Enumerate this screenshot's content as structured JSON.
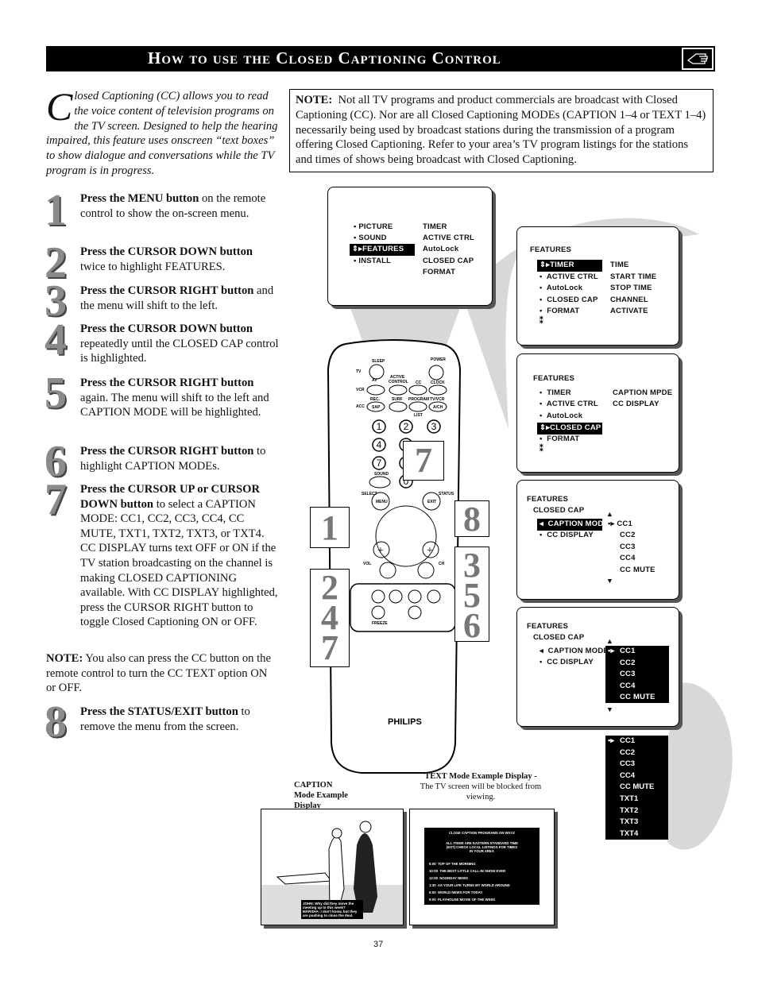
{
  "header": {
    "title": "How to use the Closed Captioning Control",
    "icon": "pointing-hand-icon"
  },
  "intro": {
    "dropcap": "C",
    "text": "losed Captioning (CC) allows you to read the voice content of television programs on the TV screen.  Designed to help the hearing impaired, this feature uses onscreen “text boxes” to show dialogue and conversations while the TV program is in progress."
  },
  "note": {
    "label": "NOTE:",
    "text": "Not all TV programs and product commercials are broadcast with Closed Captioning (CC).  Nor are all Closed Captioning  MODEs (CAPTION 1–4 or TEXT 1–4) necessarily being used by broadcast stations during the transmission of a program offering Closed Captioning.  Refer to your area’s TV program listings for the stations and times of shows being broadcast with Closed Captioning."
  },
  "steps": [
    {
      "num": "1",
      "bold": "Press the MENU button",
      "text": " on the remote control to show the on-screen menu."
    },
    {
      "num": "2",
      "bold": "Press the CURSOR DOWN button",
      "text": " twice to highlight FEATURES."
    },
    {
      "num": "3",
      "bold": "Press the CURSOR RIGHT button",
      "text": " and the menu will shift to the left."
    },
    {
      "num": "4",
      "bold": "Press the CURSOR DOWN button",
      "text": " repeatedly until the CLOSED CAP control is highlighted."
    },
    {
      "num": "5",
      "bold": "Press the CURSOR RIGHT button",
      "text": " again. The menu will shift to the left and CAPTION MODE will be highlighted."
    },
    {
      "num": "6",
      "bold": "Press the CURSOR RIGHT button",
      "text": " to highlight CAPTION MODEs."
    },
    {
      "num": "7",
      "bold": "Press the CURSOR UP or CURSOR DOWN button",
      "text": " to select a CAPTION MODE:  CC1, CC2, CC3, CC4, CC MUTE, TXT1, TXT2, TXT3, or TXT4.  CC DISPLAY turns text OFF or ON if the TV station broadcasting on the channel is making CLOSED CAPTIONING available. With CC DISPLAY highlighted, press the CURSOR RIGHT button to toggle Closed Captioning ON or OFF."
    },
    {
      "num": "8",
      "bold": "Press the STATUS/EXIT button",
      "text": " to remove the menu from the screen."
    }
  ],
  "note2": {
    "label": "NOTE:",
    "text": " You also can press the CC button on the remote control to turn the CC TEXT option ON or OFF."
  },
  "menus": {
    "main": {
      "left": [
        "PICTURE",
        "SOUND",
        "FEATURES",
        "INSTALL"
      ],
      "right": [
        "TIMER",
        "ACTIVE CTRL",
        "AutoLock",
        "CLOSED CAP",
        "FORMAT"
      ]
    },
    "features1": {
      "title": "FEATURES",
      "left": [
        "TIMER",
        "ACTIVE CTRL",
        "AutoLock",
        "CLOSED CAP",
        "FORMAT"
      ],
      "right": [
        "TIME",
        "START TIME",
        "STOP TIME",
        "CHANNEL",
        "ACTIVATE"
      ]
    },
    "features2": {
      "title": "FEATURES",
      "left": [
        "TIMER",
        "ACTIVE CTRL",
        "AutoLock",
        "CLOSED CAP",
        "FORMAT"
      ],
      "right": [
        "CAPTION MPDE",
        "CC DISPLAY"
      ]
    },
    "cc1": {
      "title": "FEATURES",
      "sub": "CLOSED CAP",
      "left": [
        "CAPTION MODE",
        "CC DISPLAY"
      ],
      "right": [
        "CC1",
        "CC2",
        "CC3",
        "CC4",
        "CC MUTE"
      ]
    },
    "cc2": {
      "title": "FEATURES",
      "sub": "CLOSED CAP",
      "left": [
        "CAPTION MODE",
        "CC DISPLAY"
      ],
      "right": [
        "CC1",
        "CC2",
        "CC3",
        "CC4",
        "CC MUTE"
      ]
    },
    "full": [
      "CC1",
      "CC2",
      "CC3",
      "CC4",
      "CC MUTE",
      "TXT1",
      "TXT2",
      "TXT3",
      "TXT4"
    ]
  },
  "remote": {
    "brand": "PHILIPS",
    "buttons": {
      "sleep": "SLEEP",
      "power": "POWER",
      "tv": "TV",
      "vcr": "VCR",
      "acc": "ACC",
      "av": "AV",
      "active": "ACTIVE",
      "control": "CONTROL",
      "cc": "CC",
      "clock": "CLOCK",
      "rec": "REC.",
      "sap": "SAP",
      "surf": "SURF",
      "program": "PROGRAM",
      "list": "LIST",
      "tvvcr": "TV/VCR",
      "ach": "A/CH",
      "sound": "SOUND",
      "select": "SELECT",
      "menu": "MENU",
      "exit": "EXIT",
      "status": "STATUS",
      "vol": "VOL",
      "ch": "CH",
      "freeze": "FREEZE"
    },
    "digits": [
      "1",
      "2",
      "3",
      "4",
      "5",
      "6",
      "7",
      "8",
      "9",
      "0"
    ],
    "callouts": [
      "7",
      "1",
      "8",
      "2 4 7",
      "3 5 6"
    ]
  },
  "examples": {
    "caption_label": "CAPTION Mode Example Display",
    "text_label_bold": "TEXT  Mode Example Display -",
    "text_label": "The TV screen will be blocked from viewing.",
    "caption_text": "JOHN: Why did they move  the meeting up to this week? MARSHA: I don't know, but they are pushing to close the deal.",
    "text_screen": {
      "title": "CLOSE CAPTION PROGRAMS ON WXYZ",
      "info": "ALL ITEMS ARE EASTERN STANDARD TIME (EST) CHECK LOCAL LISTINGS FOR TIMES IN YOUR AREA",
      "rows": [
        [
          "6:00",
          "TOP OF THE MORNING"
        ],
        [
          "10:00",
          "THE BEST LITTLE CALL-IN SHOW EVER"
        ],
        [
          "12:00",
          "NOONDAY NEWS"
        ],
        [
          "1:30",
          "AS YOUR LIFE TURNS MY WORLD AROUND"
        ],
        [
          "6:00",
          "WORLD NEWS FOR TODAY"
        ],
        [
          "9:00",
          "PLAYHOUSE MOVIE OF THE WEEK"
        ]
      ]
    }
  },
  "page_number": "37"
}
